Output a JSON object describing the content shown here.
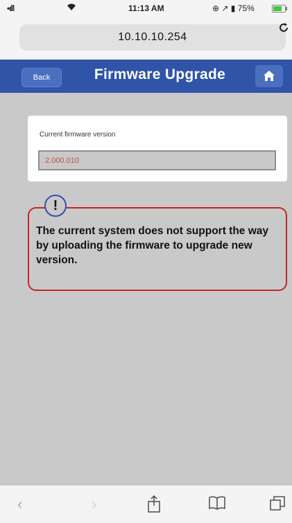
{
  "status_bar": {
    "signal": "•ıll",
    "time": "11:13 AM",
    "right_icons": "⊕ ↗ ▮ 75%",
    "battery_level": 0.75
  },
  "browser": {
    "url": "10.10.10.254",
    "reload_icon": "reload-icon"
  },
  "header": {
    "back_label": "Back",
    "title": "Firmware Upgrade",
    "home_icon": "home-icon"
  },
  "firmware": {
    "label": "Current firmware version",
    "version": "2.000.010"
  },
  "warning": {
    "icon": "!",
    "message": "The current system does not support the way by uploading the firmware to upgrade new version."
  },
  "toolbar": {
    "back_icon": "‹",
    "forward_icon": "›",
    "share_icon": "share-icon",
    "bookmarks_icon": "bookmarks-icon",
    "tabs_icon": "tabs-icon"
  },
  "colors": {
    "header_bg": "#2f54a8",
    "warning_border": "#c82424",
    "version_text": "#c84a4a"
  }
}
